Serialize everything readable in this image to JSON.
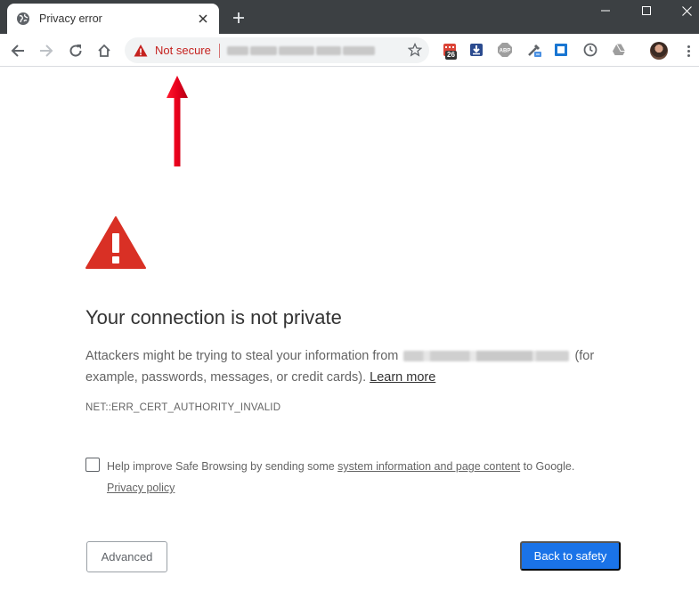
{
  "tab": {
    "title": "Privacy error"
  },
  "omnibox": {
    "security_label": "Not secure"
  },
  "extensions": {
    "calendar_badge": "26",
    "abp_label": "ABP"
  },
  "interstitial": {
    "heading": "Your connection is not private",
    "body_before": "Attackers might be trying to steal your information from",
    "body_after": "(for example, passwords, messages, or credit cards).",
    "learn_more": "Learn more",
    "error_code": "NET::ERR_CERT_AUTHORITY_INVALID",
    "safe_browsing": {
      "before": "Help improve Safe Browsing by sending some",
      "link": "system information and page content",
      "after": "to Google.",
      "privacy_policy": "Privacy policy",
      "checked": false
    },
    "advanced_button": "Advanced",
    "back_button": "Back to safety"
  },
  "colors": {
    "warning_red": "#d93025",
    "not_secure_red": "#c5221f",
    "primary_blue": "#1a73e8",
    "annotation_red": "#e8001c"
  }
}
